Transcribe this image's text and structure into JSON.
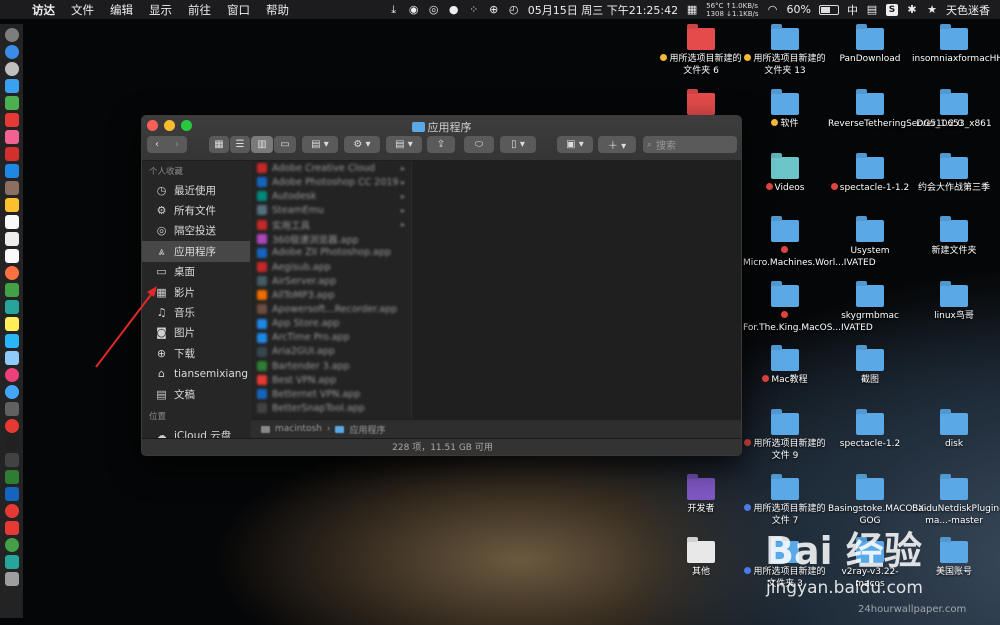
{
  "menubar": {
    "app": "访达",
    "items": [
      "文件",
      "编辑",
      "显示",
      "前往",
      "窗口",
      "帮助"
    ],
    "net_line1": "56°C ↑1.0KB/s",
    "net_line2": "1308 ↓1.1KB/s",
    "clock": "05月15日 周三 下午21:25:42",
    "battery": "60%",
    "input": "中",
    "user": "天色迷香"
  },
  "finder": {
    "title": "应用程序",
    "search_placeholder": "搜索",
    "sidebar_head_fav": "个人收藏",
    "sidebar_head_loc": "位置",
    "sidebar": [
      {
        "label": "最近使用",
        "icon": "clock-icon"
      },
      {
        "label": "所有文件",
        "icon": "gear-icon"
      },
      {
        "label": "隔空投送",
        "icon": "airdrop-icon"
      },
      {
        "label": "应用程序",
        "icon": "apps-icon"
      },
      {
        "label": "桌面",
        "icon": "desktop-icon"
      },
      {
        "label": "影片",
        "icon": "film-icon"
      },
      {
        "label": "音乐",
        "icon": "music-icon"
      },
      {
        "label": "图片",
        "icon": "camera-icon"
      },
      {
        "label": "下载",
        "icon": "download-icon"
      },
      {
        "label": "tiansemixiang",
        "icon": "home-icon"
      },
      {
        "label": "文稿",
        "icon": "document-icon"
      }
    ],
    "location_item": "iCloud 云盘",
    "files": [
      "Adobe Creative Cloud",
      "Adobe Photoshop CC 2019",
      "Autodesk",
      "SteamEmu",
      "实用工具",
      "360极速浏览器.app",
      "Adobe ZII Photoshop.app",
      "Aegisub.app",
      "AirServer.app",
      "AllToMP3.app",
      "Apowersoft...Recorder.app",
      "App Store.app",
      "ArcTime Pro.app",
      "Aria2GUI.app",
      "Bartender 3.app",
      "Best VPN.app",
      "Betternet VPN.app",
      "BetterSnapTool.app"
    ],
    "path_disk": "macintosh",
    "path_folder": "应用程序",
    "status": "228 项，11.51 GB 可用"
  },
  "desktop": [
    {
      "label": "用所选项目新建的文件夹 6"
    },
    {
      "label": "用所选项目新建的文件夹 13"
    },
    {
      "label": "PanDownload"
    },
    {
      "label": "insomniaxformacHHB_jb51"
    },
    {
      "label": "软件"
    },
    {
      "label": "ReverseTetheringServer_1.2.0"
    },
    {
      "label": "DG510653_x861"
    },
    {
      "label": "Videos"
    },
    {
      "label": "spectacle-1-1.2"
    },
    {
      "label": "约会大作战第三季"
    },
    {
      "label": "Micro.Machines.Worl...IVATED"
    },
    {
      "label": "Usystem"
    },
    {
      "label": "新建文件夹"
    },
    {
      "label": "For.The.King.MacOS...IVATED"
    },
    {
      "label": "skygrmbmac"
    },
    {
      "label": "linux鸟哥"
    },
    {
      "label": "Mac教程"
    },
    {
      "label": "截图"
    },
    {
      "label": "用所选项目新建的文件 9"
    },
    {
      "label": "spectacle-1.2"
    },
    {
      "label": "disk"
    },
    {
      "label": "开发者"
    },
    {
      "label": "用所选项目新建的文件 7"
    },
    {
      "label": "Basingstoke.MACOSX-GOG"
    },
    {
      "label": "BaiduNetdiskPlugin-ma...-master"
    },
    {
      "label": "其他"
    },
    {
      "label": "用所选项目新建的文件夹 3"
    },
    {
      "label": "v2ray-v3.22-macos"
    },
    {
      "label": "美国账号"
    }
  ],
  "watermark": {
    "brand": "Bai 经验",
    "url": "jingyan.baidu.com",
    "credit": "24hourwallpaper.com"
  }
}
